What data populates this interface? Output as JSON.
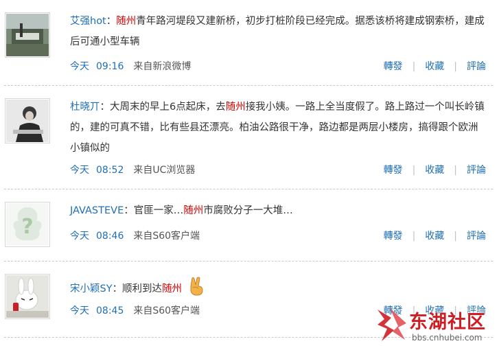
{
  "posts": [
    {
      "user": "艾强hot",
      "text_before": "：",
      "highlight": "随州",
      "text_after": "青年路河堤段又建新桥，初步打桩阶段已经完成。据悉该桥将建成钢索桥，建成后可通小型车辆",
      "day": "今天",
      "time": "09:16",
      "source": "来自新浪微博",
      "actions": [
        "轉發",
        "收藏",
        "評論"
      ]
    },
    {
      "user": "杜晓丌",
      "text_before": "：大周末的早上6点起床，去",
      "highlight": "随州",
      "text_after": "接我小姨。一路上全当度假了。路上路过一个叫长岭镇的，建的可真不错，比有些县还漂亮。柏油公路很干净，路边都是两层小楼房，搞得跟个欧洲小镇似的",
      "day": "今天",
      "time": "08:52",
      "source": "来自UC浏览器",
      "actions": [
        "轉發",
        "收藏",
        "評論"
      ]
    },
    {
      "user": "JAVASTEVE",
      "text_before": "：官匪一家…",
      "highlight": "随州",
      "text_after": "市腐败分子一大堆…",
      "day": "今天",
      "time": "08:46",
      "source": "来自S60客户端",
      "actions": [
        "轉發",
        "收藏",
        "評論"
      ]
    },
    {
      "user": "宋小颖SY",
      "text_before": "：顺利到达",
      "highlight": "随州",
      "text_after": "",
      "emoji": "peace-hand-icon",
      "day": "今天",
      "time": "08:45",
      "source": "来自S60客户端",
      "actions": [
        "轉發",
        "收藏",
        "評論"
      ]
    }
  ],
  "watermark": {
    "title": "东湖社区",
    "url": "bbs.cnhubei.com",
    "logo_icon": "cnhubei-logo-icon",
    "brand_color": "#cf1d24"
  },
  "colors": {
    "link": "#1e6fb5",
    "highlight": "#d40000",
    "divider": "#c8c8c8"
  }
}
